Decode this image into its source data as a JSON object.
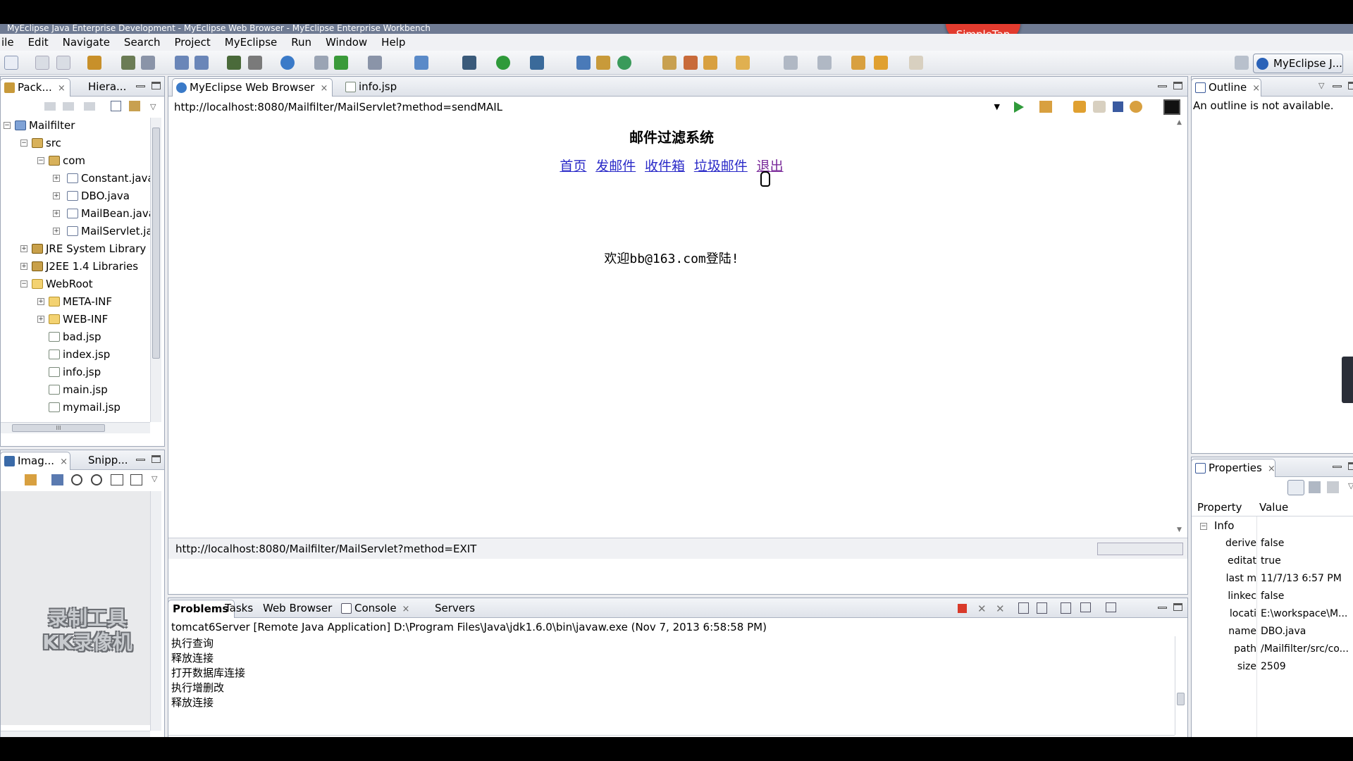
{
  "window": {
    "title": "MyEclipse Java Enterprise Development - MyEclipse Web Browser - MyEclipse Enterprise Workbench",
    "overlay_badge": "SimpleTap"
  },
  "menu": [
    "ile",
    "Edit",
    "Navigate",
    "Search",
    "Project",
    "MyEclipse",
    "Run",
    "Window",
    "Help"
  ],
  "perspective": {
    "label": "MyEclipse J..."
  },
  "package_explorer": {
    "tabs": [
      {
        "label": "Pack...",
        "close": "×"
      },
      {
        "label": "Hiera..."
      }
    ],
    "tree": [
      {
        "label": "Mailfilter",
        "icon": "project-icon"
      },
      {
        "label": "src",
        "icon": "source-folder-icon"
      },
      {
        "label": "com",
        "icon": "package-icon"
      },
      {
        "label": "Constant.java",
        "icon": "java-file-icon"
      },
      {
        "label": "DBO.java",
        "icon": "java-file-icon"
      },
      {
        "label": "MailBean.java",
        "icon": "java-file-icon"
      },
      {
        "label": "MailServlet.ja",
        "icon": "java-file-icon"
      },
      {
        "label": "JRE System Library",
        "icon": "library-icon"
      },
      {
        "label": "J2EE 1.4 Libraries",
        "icon": "library-icon"
      },
      {
        "label": "WebRoot",
        "icon": "folder-icon"
      },
      {
        "label": "META-INF",
        "icon": "folder-icon"
      },
      {
        "label": "WEB-INF",
        "icon": "folder-icon"
      },
      {
        "label": "bad.jsp",
        "icon": "jsp-file-icon"
      },
      {
        "label": "index.jsp",
        "icon": "jsp-file-icon"
      },
      {
        "label": "info.jsp",
        "icon": "jsp-file-icon"
      },
      {
        "label": "main.jsp",
        "icon": "jsp-file-icon"
      },
      {
        "label": "mymail.jsp",
        "icon": "jsp-file-icon"
      }
    ],
    "scroll_label": "III"
  },
  "image_panel": {
    "tabs": [
      {
        "label": "Imag...",
        "close": "×"
      },
      {
        "label": "Snipp..."
      }
    ],
    "watermark_line1": "录制工具",
    "watermark_line2": "KK录像机"
  },
  "editor": {
    "tabs": [
      {
        "label": "MyEclipse Web Browser",
        "close": "×"
      },
      {
        "label": "info.jsp"
      }
    ],
    "url": "http://localhost:8080/Mailfilter/MailServlet?method=sendMAIL",
    "status_url": "http://localhost:8080/Mailfilter/MailServlet?method=EXIT",
    "page": {
      "heading": "邮件过滤系统",
      "links": [
        "首页",
        "发邮件",
        "收件箱",
        "垃圾邮件",
        "退出"
      ],
      "welcome": "欢迎bb@163.com登陆!"
    }
  },
  "bottom_panel": {
    "tabs": [
      "Problems",
      "Tasks",
      "Web Browser",
      "Console",
      "Servers"
    ],
    "console_close": "×",
    "console_header": "tomcat6Server [Remote Java Application] D:\\Program Files\\Java\\jdk1.6.0\\bin\\javaw.exe (Nov 7, 2013 6:58:58 PM)",
    "lines": [
      "执行查询",
      "释放连接",
      "打开数据库连接",
      "执行增删改",
      "释放连接"
    ]
  },
  "outline": {
    "tab": "Outline",
    "close": "×",
    "message": "An outline is not available."
  },
  "properties": {
    "tab": "Properties",
    "close": "×",
    "col_property": "Property",
    "col_value": "Value",
    "group": "Info",
    "rows": [
      {
        "k": "derive",
        "v": "false"
      },
      {
        "k": "editat",
        "v": "true"
      },
      {
        "k": "last m",
        "v": "11/7/13 6:57 PM"
      },
      {
        "k": "linkec",
        "v": "false"
      },
      {
        "k": "locati",
        "v": "E:\\workspace\\M..."
      },
      {
        "k": "name",
        "v": "DBO.java"
      },
      {
        "k": "path",
        "v": "/Mailfilter/src/co..."
      },
      {
        "k": "size",
        "v": "2509"
      }
    ]
  },
  "colors": {
    "link": "#2a2ac8",
    "selection": "#ffffff",
    "badge": "#e23b2e",
    "terminate_button": "#d93a2a"
  }
}
